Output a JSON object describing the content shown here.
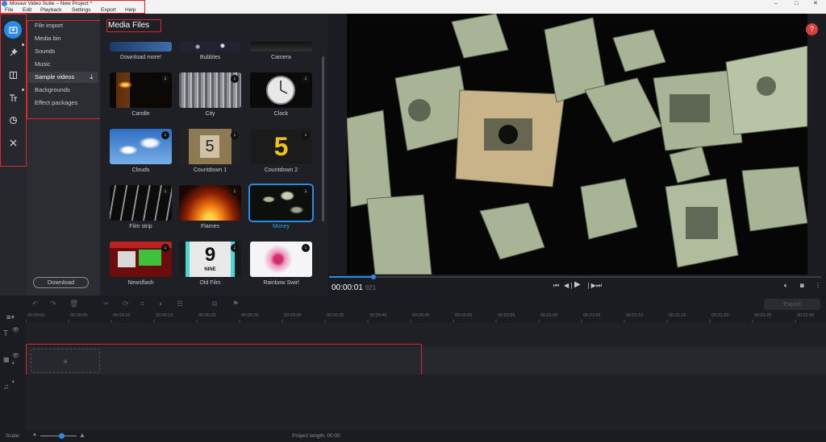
{
  "window": {
    "title": "Movavi Video Suite – New Project *",
    "minimize": "–",
    "maximize": "□",
    "close": "✕"
  },
  "menu": [
    "File",
    "Edit",
    "Playback",
    "Settings",
    "Export",
    "Help"
  ],
  "sidebar_icons": [
    "import-icon",
    "magic-wand-icon",
    "transitions-icon",
    "titles-icon",
    "filters-icon",
    "tools-icon"
  ],
  "categories": [
    {
      "label": "File import"
    },
    {
      "label": "Media bin"
    },
    {
      "label": "Sounds"
    },
    {
      "label": "Music"
    },
    {
      "label": "Sample videos"
    },
    {
      "label": "Backgrounds"
    },
    {
      "label": "Effect packages"
    }
  ],
  "download_button": "Download",
  "media": {
    "title": "Media Files",
    "items": [
      {
        "label": "Download more!"
      },
      {
        "label": "Bubbles"
      },
      {
        "label": "Camera"
      },
      {
        "label": "Candle"
      },
      {
        "label": "City"
      },
      {
        "label": "Clock"
      },
      {
        "label": "Clouds"
      },
      {
        "label": "Countdown 1"
      },
      {
        "label": "Countdown 2"
      },
      {
        "label": "Film strip"
      },
      {
        "label": "Flames"
      },
      {
        "label": "Money"
      },
      {
        "label": "Newsflash"
      },
      {
        "label": "Old Film"
      },
      {
        "label": "Rainbow Swirl"
      }
    ],
    "countdown1_digit": "5",
    "countdown2_digit": "5",
    "oldfilm_digit": "9",
    "oldfilm_word": "NINE"
  },
  "player": {
    "time_main": "00:00:01",
    "time_ms": "921",
    "progress": 0.09
  },
  "help_label": "?",
  "export_label": "Export",
  "ruler_ticks": [
    "00:00:00",
    "00:00:05",
    "00:00:10",
    "00:00:15",
    "00:00:20",
    "00:00:25",
    "00:00:30",
    "00:00:35",
    "00:00:40",
    "00:00:45",
    "00:00:50",
    "00:00:55",
    "00:01:00",
    "00:01:05",
    "00:01:10",
    "00:01:15",
    "00:01:20",
    "00:01:25",
    "00:01:30"
  ],
  "add_slot_symbol": "+",
  "status": {
    "scale_label": "Scale:",
    "project_length": "Project length: 00:00"
  },
  "colors": {
    "accent": "#2a8be6",
    "highlight": "#e0252b",
    "help": "#d9423b"
  }
}
